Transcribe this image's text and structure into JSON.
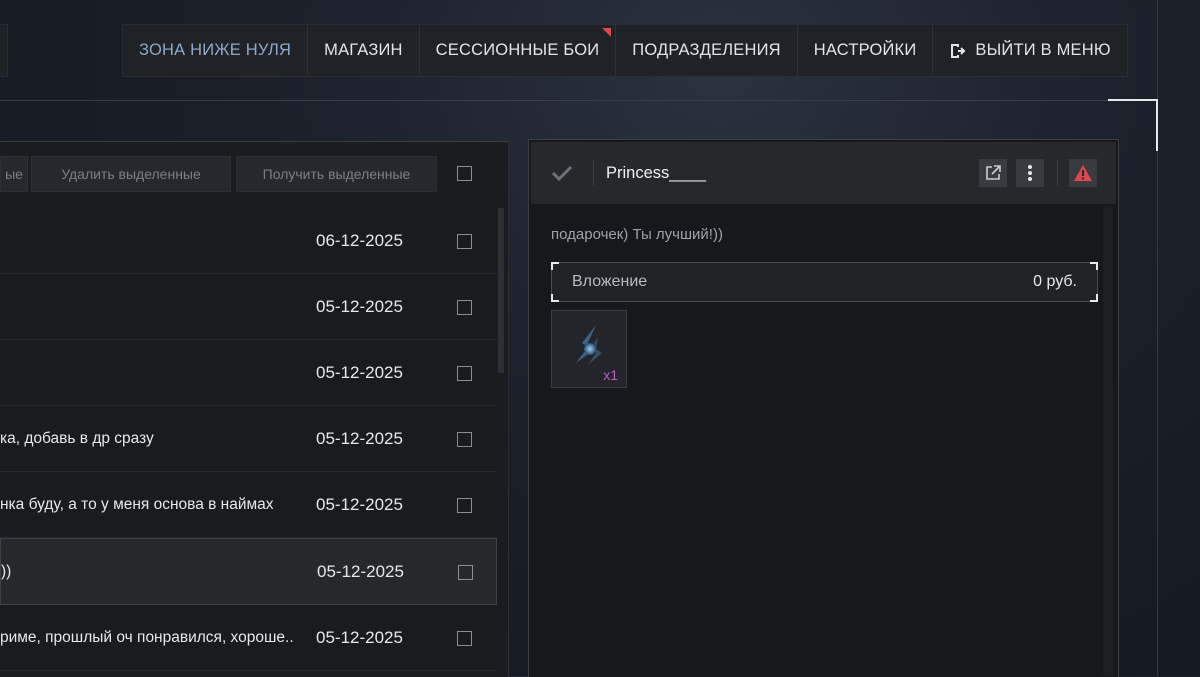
{
  "nav": {
    "items": [
      {
        "label": "ЗОНА НИЖЕ НУЛЯ",
        "active": true
      },
      {
        "label": "МАГАЗИН"
      },
      {
        "label": "СЕССИОННЫЕ БОИ",
        "marker": true
      },
      {
        "label": "ПОДРАЗДЕЛЕНИЯ"
      },
      {
        "label": "НАСТРОЙКИ"
      },
      {
        "label": "ВЫЙТИ В МЕНЮ",
        "icon": "exit-icon"
      }
    ]
  },
  "toolbar": {
    "partial_label": "ые",
    "delete_label": "Удалить выделенные",
    "receive_label": "Получить выделенные"
  },
  "messages": [
    {
      "text": "",
      "date": "06-12-2025"
    },
    {
      "text": "",
      "date": "05-12-2025"
    },
    {
      "text": "",
      "date": "05-12-2025"
    },
    {
      "text": "ка, добавь в др сразу",
      "date": "05-12-2025"
    },
    {
      "text": "нка буду, а то у меня основа в наймах",
      "date": "05-12-2025"
    },
    {
      "text": "))",
      "date": "05-12-2025",
      "selected": true
    },
    {
      "text": "риме, прошлый оч понравился, хороше..",
      "date": "05-12-2025"
    }
  ],
  "detail": {
    "sender": "Princess____",
    "message": "подарочек) Ты лучший!))",
    "attachment_label": "Вложение",
    "attachment_value": "0 руб.",
    "item_qty": "x1"
  },
  "colors": {
    "active_nav": "#8fa7c9",
    "alert": "#e0474c",
    "qty": "#c05ac8"
  }
}
